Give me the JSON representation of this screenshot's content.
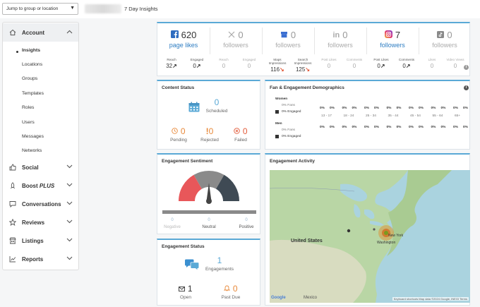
{
  "topbar": {
    "jump_label": "Jump to group or location",
    "page_title": "7 Day Insights"
  },
  "sidebar": {
    "account": {
      "label": "Account",
      "items": [
        "Insights",
        "Locations",
        "Groups",
        "Templates",
        "Roles",
        "Users",
        "Messages",
        "Networks"
      ]
    },
    "sections": [
      {
        "label": "Social"
      },
      {
        "label": "Boost",
        "suffix": "PLUS"
      },
      {
        "label": "Conversations"
      },
      {
        "label": "Reviews"
      },
      {
        "label": "Listings"
      },
      {
        "label": "Reports"
      }
    ]
  },
  "social": {
    "facebook": {
      "count": "620",
      "label": "page likes",
      "metrics": [
        {
          "name": "Reach",
          "value": "32"
        },
        {
          "name": "Engaged",
          "value": "0"
        }
      ]
    },
    "x": {
      "count": "0",
      "label": "followers",
      "metrics": [
        {
          "name": "Reach",
          "value": "0"
        },
        {
          "name": "Engaged",
          "value": "0"
        }
      ]
    },
    "gbp": {
      "count": "0",
      "label": "followers",
      "metrics": [
        {
          "name": "Maps Impressions",
          "value": "116"
        },
        {
          "name": "Search Impressions",
          "value": "125"
        }
      ]
    },
    "linkedin": {
      "count": "0",
      "label": "followers",
      "metrics": [
        {
          "name": "Post Likes",
          "value": "0"
        },
        {
          "name": "Comments",
          "value": "0"
        }
      ]
    },
    "instagram": {
      "count": "7",
      "label": "followers",
      "metrics": [
        {
          "name": "Post Likes",
          "value": "0"
        },
        {
          "name": "Comments",
          "value": "0"
        }
      ]
    },
    "tiktok": {
      "count": "0",
      "label": "followers",
      "metrics": [
        {
          "name": "Likes",
          "value": "0"
        },
        {
          "name": "Video Views",
          "value": "0"
        }
      ]
    }
  },
  "content_status": {
    "title": "Content Status",
    "scheduled": {
      "value": "0",
      "label": "Scheduled"
    },
    "pending": {
      "value": "0",
      "label": "Pending"
    },
    "rejected": {
      "value": "0",
      "label": "Rejected"
    },
    "failed": {
      "value": "0",
      "label": "Failed"
    }
  },
  "demographics": {
    "title": "Fan & Engagement Demographics",
    "women": "Women",
    "men": "Men",
    "fans": "0% Fans",
    "engaged": "0% Engaged",
    "age_groups": [
      "13 - 17",
      "18 - 24",
      "25 - 34",
      "35 - 44",
      "45 - 54",
      "55 - 64",
      "65+"
    ],
    "pct": "0%"
  },
  "sentiment": {
    "title": "Engagement Sentiment",
    "negative": {
      "label": "Negative",
      "value": "0"
    },
    "neutral": {
      "label": "Neutral",
      "value": "0"
    },
    "positive": {
      "label": "Positive",
      "value": "0"
    },
    "needle_fraction": 0.5,
    "colors": {
      "negative": "#e8575a",
      "neutral": "#8a8a8a",
      "positive": "#3f4a54"
    }
  },
  "engagement_status": {
    "title": "Engagement Status",
    "engagements": {
      "value": "1",
      "label": "Engagements"
    },
    "open": {
      "value": "1",
      "label": "Open"
    },
    "past_due": {
      "value": "0",
      "label": "Past Due"
    }
  },
  "activity": {
    "title": "Engagement Activity",
    "map_labels": {
      "united_states": "United States",
      "mexico": "Mexico",
      "new_york": "New York",
      "washington": "Washington",
      "google": "Google"
    },
    "attribution": "Keyboard shortcuts   Map data ©2024 Google, INEGI   Terms"
  },
  "colors": {
    "accent": "#2e7dc2",
    "card_top": "#5aa9d6",
    "orange": "#e8893a",
    "red": "#e25b3a"
  }
}
